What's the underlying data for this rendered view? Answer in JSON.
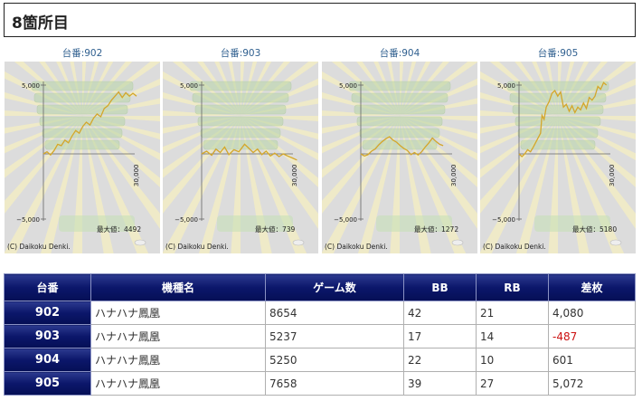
{
  "page": {
    "title": "8箇所目"
  },
  "graphs": [
    {
      "caption": "台番:902",
      "max_label": "最大値：4492",
      "series": [
        [
          0,
          0
        ],
        [
          0.5,
          150
        ],
        [
          1,
          -80
        ],
        [
          1.5,
          250
        ],
        [
          2,
          700
        ],
        [
          2.5,
          600
        ],
        [
          3,
          1000
        ],
        [
          3.5,
          800
        ],
        [
          4,
          1300
        ],
        [
          4.5,
          1700
        ],
        [
          5,
          1500
        ],
        [
          5.5,
          2000
        ],
        [
          6,
          2300
        ],
        [
          6.5,
          2100
        ],
        [
          7,
          2600
        ],
        [
          7.5,
          2900
        ],
        [
          8,
          2700
        ],
        [
          8.5,
          3300
        ],
        [
          9,
          3500
        ],
        [
          9.5,
          3900
        ],
        [
          10,
          4200
        ],
        [
          10.5,
          4500
        ],
        [
          11,
          4100
        ],
        [
          11.5,
          4450
        ],
        [
          12,
          4200
        ],
        [
          12.5,
          4400
        ],
        [
          13,
          4200
        ]
      ]
    },
    {
      "caption": "台番:903",
      "max_label": "最大値：739",
      "series": [
        [
          0,
          0
        ],
        [
          0.7,
          200
        ],
        [
          1.4,
          -100
        ],
        [
          2,
          350
        ],
        [
          2.6,
          100
        ],
        [
          3.2,
          500
        ],
        [
          3.8,
          -50
        ],
        [
          4.5,
          300
        ],
        [
          5.2,
          150
        ],
        [
          6,
          700
        ],
        [
          6.6,
          400
        ],
        [
          7.2,
          100
        ],
        [
          7.8,
          350
        ],
        [
          8.4,
          -50
        ],
        [
          9,
          200
        ],
        [
          9.6,
          -150
        ],
        [
          10.2,
          50
        ],
        [
          10.8,
          -200
        ],
        [
          11.4,
          0
        ],
        [
          12,
          -150
        ],
        [
          12.7,
          -300
        ],
        [
          13.3,
          -450
        ]
      ]
    },
    {
      "caption": "台番:904",
      "max_label": "最大値：1272",
      "series": [
        [
          0,
          0
        ],
        [
          0.5,
          -150
        ],
        [
          1,
          -60
        ],
        [
          1.5,
          200
        ],
        [
          2,
          350
        ],
        [
          2.5,
          650
        ],
        [
          3,
          900
        ],
        [
          3.5,
          1100
        ],
        [
          4,
          1250
        ],
        [
          4.5,
          1000
        ],
        [
          5,
          850
        ],
        [
          5.5,
          600
        ],
        [
          6,
          400
        ],
        [
          6.5,
          250
        ],
        [
          7,
          -50
        ],
        [
          7.5,
          100
        ],
        [
          8,
          -80
        ],
        [
          8.5,
          150
        ],
        [
          9,
          500
        ],
        [
          9.5,
          800
        ],
        [
          10,
          1150
        ],
        [
          10.5,
          900
        ],
        [
          11,
          700
        ],
        [
          11.5,
          600
        ]
      ]
    },
    {
      "caption": "台番:905",
      "max_label": "最大値：5180",
      "series": [
        [
          0,
          0
        ],
        [
          0.4,
          -200
        ],
        [
          0.8,
          0
        ],
        [
          1.2,
          300
        ],
        [
          1.6,
          150
        ],
        [
          2,
          500
        ],
        [
          2.5,
          1000
        ],
        [
          3,
          1500
        ],
        [
          3.2,
          2800
        ],
        [
          3.5,
          2500
        ],
        [
          3.8,
          3400
        ],
        [
          4.2,
          3800
        ],
        [
          4.6,
          4400
        ],
        [
          5,
          4600
        ],
        [
          5.4,
          4200
        ],
        [
          5.8,
          4500
        ],
        [
          6.2,
          3400
        ],
        [
          6.6,
          3600
        ],
        [
          7,
          3100
        ],
        [
          7.4,
          3500
        ],
        [
          7.8,
          3000
        ],
        [
          8.2,
          3400
        ],
        [
          8.6,
          3200
        ],
        [
          9,
          3700
        ],
        [
          9.4,
          3300
        ],
        [
          9.8,
          4100
        ],
        [
          10.2,
          3900
        ],
        [
          10.6,
          4200
        ],
        [
          11,
          4900
        ],
        [
          11.4,
          4700
        ],
        [
          11.8,
          5180
        ],
        [
          12.2,
          5000
        ]
      ]
    }
  ],
  "graph_common": {
    "y_top_label": "5,000",
    "y_bottom_label": "−5,000",
    "x_label": "30,000",
    "copyright": "(C) Daikoku Denki.",
    "line_color": "#d4a62a"
  },
  "chart_data": [
    {
      "type": "line",
      "title": "台番:902",
      "ylim": [
        -5000,
        5000
      ],
      "xlabel": "30,000",
      "annotations": [
        "最大値：4492"
      ],
      "series": [
        {
          "values": [
            0,
            150,
            -80,
            250,
            700,
            600,
            1000,
            800,
            1300,
            1700,
            1500,
            2000,
            2300,
            2100,
            2600,
            2900,
            2700,
            3300,
            3500,
            3900,
            4200,
            4500,
            4100,
            4450,
            4200,
            4400,
            4200
          ]
        }
      ]
    },
    {
      "type": "line",
      "title": "台番:903",
      "ylim": [
        -5000,
        5000
      ],
      "xlabel": "30,000",
      "annotations": [
        "最大値：739"
      ],
      "series": [
        {
          "values": [
            0,
            200,
            -100,
            350,
            100,
            500,
            -50,
            300,
            150,
            700,
            400,
            100,
            350,
            -50,
            200,
            -150,
            50,
            -200,
            0,
            -150,
            -300,
            -450
          ]
        }
      ]
    },
    {
      "type": "line",
      "title": "台番:904",
      "ylim": [
        -5000,
        5000
      ],
      "xlabel": "30,000",
      "annotations": [
        "最大値：1272"
      ],
      "series": [
        {
          "values": [
            0,
            -150,
            -60,
            200,
            350,
            650,
            900,
            1100,
            1250,
            1000,
            850,
            600,
            400,
            250,
            -50,
            100,
            -80,
            150,
            500,
            800,
            1150,
            900,
            700,
            600
          ]
        }
      ]
    },
    {
      "type": "line",
      "title": "台番:905",
      "ylim": [
        -5000,
        5000
      ],
      "xlabel": "30,000",
      "annotations": [
        "最大値：5180"
      ],
      "series": [
        {
          "values": [
            0,
            -200,
            0,
            300,
            150,
            500,
            1000,
            1500,
            2800,
            2500,
            3400,
            3800,
            4400,
            4600,
            4200,
            4500,
            3400,
            3600,
            3100,
            3500,
            3000,
            3400,
            3200,
            3700,
            3300,
            4100,
            3900,
            4200,
            4900,
            4700,
            5180,
            5000
          ]
        }
      ]
    }
  ],
  "table": {
    "headers": [
      "台番",
      "機種名",
      "ゲーム数",
      "BB",
      "RB",
      "差枚"
    ],
    "rows": [
      {
        "no": "902",
        "model": "ハナハナ鳳凰",
        "games": "8654",
        "bb": "42",
        "rb": "21",
        "diff": "4,080",
        "neg": false
      },
      {
        "no": "903",
        "model": "ハナハナ鳳凰",
        "games": "5237",
        "bb": "17",
        "rb": "14",
        "diff": "-487",
        "neg": true
      },
      {
        "no": "904",
        "model": "ハナハナ鳳凰",
        "games": "5250",
        "bb": "22",
        "rb": "10",
        "diff": "601",
        "neg": false
      },
      {
        "no": "905",
        "model": "ハナハナ鳳凰",
        "games": "7658",
        "bb": "39",
        "rb": "27",
        "diff": "5,072",
        "neg": false
      }
    ]
  }
}
